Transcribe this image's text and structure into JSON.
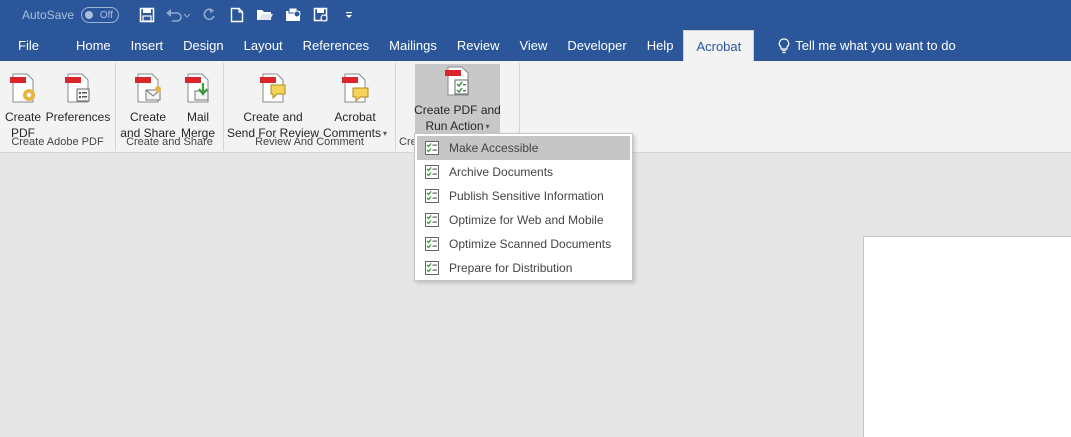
{
  "titlebar": {
    "autosave_label": "AutoSave",
    "autosave_state": "Off",
    "quick_access": [
      {
        "icon": "save-icon"
      },
      {
        "icon": "undo-icon"
      },
      {
        "icon": "redo-icon"
      },
      {
        "icon": "new-document-icon"
      },
      {
        "icon": "open-folder-icon"
      },
      {
        "icon": "save-as-pdf-icon"
      },
      {
        "icon": "print-preview-icon"
      },
      {
        "icon": "customize-qat-icon"
      }
    ]
  },
  "tabs": [
    "File",
    "Home",
    "Insert",
    "Design",
    "Layout",
    "References",
    "Mailings",
    "Review",
    "View",
    "Developer",
    "Help",
    "Acrobat"
  ],
  "active_tab": "Acrobat",
  "tell_me": "Tell me what you want to do",
  "ribbon": {
    "groups": [
      {
        "label": "Create Adobe PDF",
        "buttons": [
          {
            "line1": "Create",
            "line2": "PDF",
            "icon": "create-pdf-icon"
          },
          {
            "line1": "Preferences",
            "line2": "",
            "icon": "preferences-icon"
          }
        ]
      },
      {
        "label": "Create and Share",
        "buttons": [
          {
            "line1": "Create",
            "line2": "and Share",
            "icon": "create-and-share-icon"
          },
          {
            "line1": "Mail",
            "line2": "Merge",
            "icon": "mail-merge-icon"
          }
        ]
      },
      {
        "label": "Review And Comment",
        "buttons": [
          {
            "line1": "Create and",
            "line2": "Send For Review",
            "icon": "send-for-review-icon"
          },
          {
            "line1": "Acrobat",
            "line2": "Comments",
            "icon": "acrobat-comments-icon"
          }
        ]
      },
      {
        "label": "Cre",
        "buttons": [
          {
            "line1": "Create PDF and",
            "line2": "Run Action",
            "icon": "create-pdf-run-action-icon"
          }
        ]
      }
    ]
  },
  "menu": {
    "items": [
      {
        "label": "Make Accessible",
        "highlighted": true
      },
      {
        "label": "Archive Documents",
        "highlighted": false
      },
      {
        "label": "Publish Sensitive Information",
        "highlighted": false
      },
      {
        "label": "Optimize for Web and Mobile",
        "highlighted": false
      },
      {
        "label": "Optimize Scanned Documents",
        "highlighted": false
      },
      {
        "label": "Prepare for Distribution",
        "highlighted": false
      }
    ]
  },
  "colors": {
    "title_bar": "#2b579a",
    "ribbon_bg": "#f3f3f3",
    "workspace_bg": "#e6e6e6",
    "menu_hover": "#c6c6c6"
  }
}
